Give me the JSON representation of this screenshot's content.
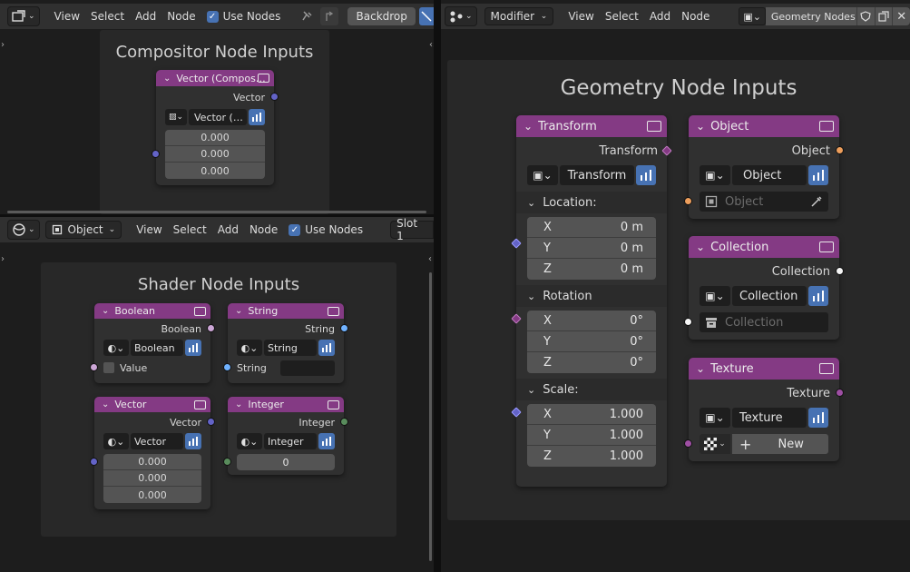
{
  "left_top_header": {
    "menus": [
      "View",
      "Select",
      "Add",
      "Node"
    ],
    "use_nodes_label": "Use Nodes",
    "backdrop_label": "Backdrop"
  },
  "compositor": {
    "frame_title": "Compositor Node Inputs",
    "node_title": "Vector (Compos…",
    "output_label": "Vector",
    "datatype_label": "Vector (…",
    "values": [
      "0.000",
      "0.000",
      "0.000"
    ]
  },
  "left_bottom_header": {
    "object_dropdown": "Object",
    "menus": [
      "View",
      "Select",
      "Add",
      "Node"
    ],
    "use_nodes_label": "Use Nodes",
    "slot_label": "Slot 1"
  },
  "shader": {
    "frame_title": "Shader Node Inputs",
    "boolean": {
      "title": "Boolean",
      "output": "Boolean",
      "datatype": "Boolean",
      "value_label": "Value"
    },
    "string": {
      "title": "String",
      "output": "String",
      "datatype": "String",
      "value_label": "String"
    },
    "vector": {
      "title": "Vector",
      "output": "Vector",
      "datatype": "Vector",
      "values": [
        "0.000",
        "0.000",
        "0.000"
      ]
    },
    "integer": {
      "title": "Integer",
      "output": "Integer",
      "datatype": "Integer",
      "value": "0"
    }
  },
  "right_header": {
    "mode_dropdown": "Modifier",
    "menus": [
      "View",
      "Select",
      "Add",
      "Node"
    ],
    "tree_name": "Geometry Nodes"
  },
  "geometry": {
    "frame_title": "Geometry Node Inputs",
    "transform": {
      "title": "Transform",
      "output": "Transform",
      "datatype": "Transform",
      "location_label": "Location:",
      "location": [
        [
          "X",
          "0 m"
        ],
        [
          "Y",
          "0 m"
        ],
        [
          "Z",
          "0 m"
        ]
      ],
      "rotation_label": "Rotation",
      "rotation": [
        [
          "X",
          "0°"
        ],
        [
          "Y",
          "0°"
        ],
        [
          "Z",
          "0°"
        ]
      ],
      "scale_label": "Scale:",
      "scale": [
        [
          "X",
          "1.000"
        ],
        [
          "Y",
          "1.000"
        ],
        [
          "Z",
          "1.000"
        ]
      ]
    },
    "object": {
      "title": "Object",
      "output": "Object",
      "datatype": "Object",
      "placeholder": "Object"
    },
    "collection": {
      "title": "Collection",
      "output": "Collection",
      "datatype": "Collection",
      "placeholder": "Collection"
    },
    "texture": {
      "title": "Texture",
      "output": "Texture",
      "datatype": "Texture",
      "new_label": "New"
    }
  },
  "colors": {
    "node_header": "#843a84",
    "socket_vector": "#6363c7",
    "socket_boolean": "#cca6d6",
    "socket_string": "#70b2ff",
    "socket_integer": "#598c5c",
    "socket_object": "#ed9e5c",
    "socket_collection": "#f5f5f5",
    "socket_texture": "#9e4fa3",
    "accent": "#4772b3"
  }
}
